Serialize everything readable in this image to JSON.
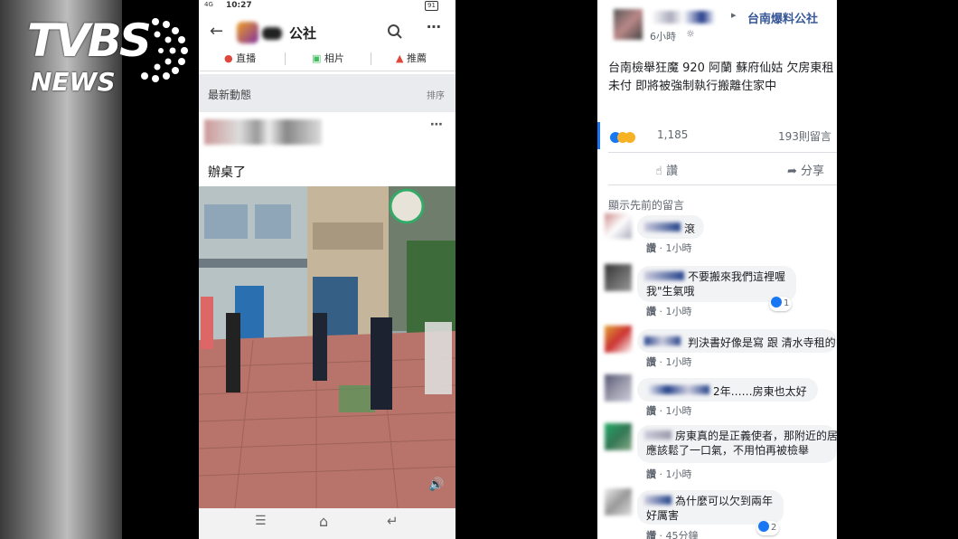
{
  "watermark": {
    "brand": "TVBS",
    "sub": "NEWS"
  },
  "phone": {
    "status": {
      "time": "10:27",
      "battery": "91"
    },
    "appbar": {
      "title": "公社"
    },
    "tabs": [
      "直播",
      "相片",
      "推薦"
    ],
    "feed": {
      "heading": "最新動態",
      "sort": "排序"
    },
    "post": {
      "text": "辦桌了"
    }
  },
  "fb": {
    "page_name": "台南爆料公社",
    "time": "6小時",
    "post_text": "台南檢舉狂魔 920 阿蘭 蘇府仙姑 欠房東租 未付 即將被強制執行搬離住家中",
    "reaction_count": "1,185",
    "comment_count": "193則留言",
    "actions": {
      "like": "讚",
      "share": "分享"
    },
    "show_previous": "顯示先前的留言",
    "comments": [
      {
        "text": "滾",
        "like_label": "讚",
        "time": "1小時"
      },
      {
        "text": "不要搬來我們這裡喔 我\"生氣哦",
        "like_label": "讚",
        "time": "1小時",
        "reactions": "1"
      },
      {
        "text": "判決書好像是寫 跟 清水寺租的",
        "like_label": "讚",
        "time": "1小時"
      },
      {
        "text": "2年……房東也太好",
        "like_label": "讚",
        "time": "1小時"
      },
      {
        "text": "房東真的是正義使者，那附近的居民，應該鬆了一口氣，不用怕再被檢舉",
        "like_label": "讚",
        "time": "1小時"
      },
      {
        "text": "為什麼可以欠到兩年 好厲害",
        "like_label": "讚",
        "time": "45分鐘",
        "reactions": "2"
      }
    ]
  },
  "colors": {
    "fb_blue": "#1877f2",
    "page_link": "#385898"
  }
}
